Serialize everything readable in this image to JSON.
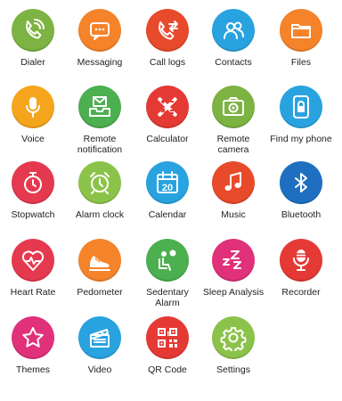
{
  "apps": [
    {
      "label": "Dialer",
      "icon": "phone-icon",
      "color": "#7cb342"
    },
    {
      "label": "Messaging",
      "icon": "message-icon",
      "color": "#f5832a"
    },
    {
      "label": "Call logs",
      "icon": "call-log-icon",
      "color": "#e84a2c"
    },
    {
      "label": "Contacts",
      "icon": "contacts-icon",
      "color": "#29a3e0"
    },
    {
      "label": "Files",
      "icon": "folder-icon",
      "color": "#f5832a"
    },
    {
      "label": "Voice",
      "icon": "microphone-icon",
      "color": "#f5a51c"
    },
    {
      "label": "Remote",
      "label2": "notification",
      "icon": "inbox-tray-icon",
      "color": "#4caf50"
    },
    {
      "label": "Calculator",
      "icon": "calculator-icon",
      "color": "#e53935"
    },
    {
      "label": "Remote",
      "label2": "camera",
      "icon": "camera-icon",
      "color": "#7cb342"
    },
    {
      "label": "Find my phone",
      "icon": "phone-lock-icon",
      "color": "#29a3e0"
    },
    {
      "label": "Stopwatch",
      "icon": "stopwatch-icon",
      "color": "#e53950"
    },
    {
      "label": "Alarm clock",
      "icon": "alarm-clock-icon",
      "color": "#8bc34a"
    },
    {
      "label": "Calendar",
      "icon": "calendar-icon",
      "color": "#29a3e0",
      "badge": "20"
    },
    {
      "label": "Music",
      "icon": "music-note-icon",
      "color": "#e84a2c"
    },
    {
      "label": "Bluetooth",
      "icon": "bluetooth-icon",
      "color": "#1e6fc0"
    },
    {
      "label": "Heart Rate",
      "icon": "heart-rate-icon",
      "color": "#e53950"
    },
    {
      "label": "Pedometer",
      "icon": "shoe-icon",
      "color": "#f5832a"
    },
    {
      "label": "Sedentary",
      "label2": "Alarm",
      "icon": "sedentary-icon",
      "color": "#4caf50"
    },
    {
      "label": "Sleep Analysis",
      "icon": "sleep-zzz-icon",
      "color": "#e0317a"
    },
    {
      "label": "Recorder",
      "icon": "recorder-mic-icon",
      "color": "#e53935"
    },
    {
      "label": "Themes",
      "icon": "star-icon",
      "color": "#e0317a"
    },
    {
      "label": "Video",
      "icon": "clapperboard-icon",
      "color": "#29a3e0"
    },
    {
      "label": "QR Code",
      "icon": "qr-code-icon",
      "color": "#e53935"
    },
    {
      "label": "Settings",
      "icon": "gear-icon",
      "color": "#8bc34a"
    }
  ]
}
